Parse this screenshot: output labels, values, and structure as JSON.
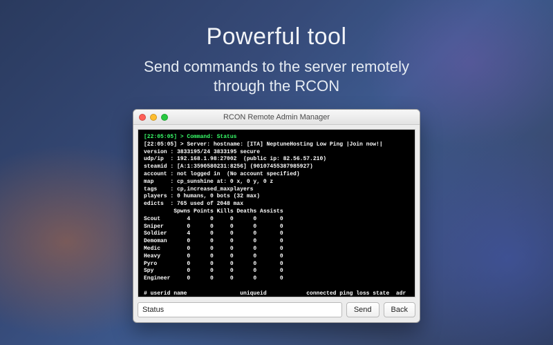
{
  "hero": {
    "title": "Powerful tool",
    "subtitle_line1": "Send commands to the server remotely",
    "subtitle_line2": "through the RCON"
  },
  "window": {
    "title": "RCON Remote Admin Manager"
  },
  "terminal": {
    "command_line": "[22:05:05] > Command: Status",
    "response_line": "[22:05:05] > Server: hostname: [ITA] NeptuneHosting Low Ping |Join now!|",
    "lines": [
      "version : 3833195/24 3833195 secure",
      "udp/ip  : 192.168.1.98:27002  (public ip: 82.56.57.210)",
      "steamid : [A:1:3590580231:8256] (90107455387985927)",
      "account : not logged in  (No account specified)",
      "map     : cp_sunshine at: 0 x, 0 y, 0 z",
      "tags    : cp,increased_maxplayers",
      "players : 0 humans, 0 bots (32 max)",
      "edicts  : 765 used of 2048 max",
      "         Spwns Points Kills Deaths Assists",
      "Scout        4      0     0      0       0",
      "Sniper       0      0     0      0       0",
      "Soldier      4      0     0      0       0",
      "Demoman      0      0     0      0       0",
      "Medic        0      0     0      0       0",
      "Heavy        0      0     0      0       0",
      "Pyro         0      0     0      0       0",
      "Spy          0      0     0      0       0",
      "Engineer     0      0     0      0       0",
      "",
      "# userid name                uniqueid            connected ping loss state  adr"
    ]
  },
  "input": {
    "value": "Status",
    "placeholder": ""
  },
  "buttons": {
    "send": "Send",
    "back": "Back"
  }
}
